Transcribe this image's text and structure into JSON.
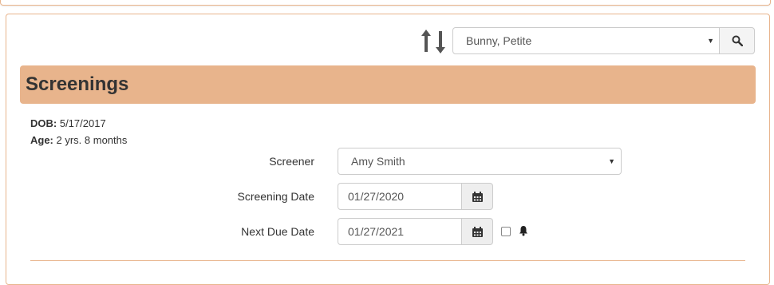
{
  "patient_picker": {
    "selected": "Bunny, Petite",
    "sort_icon": "sort-up-down-icon",
    "search_icon": "search-icon"
  },
  "header": {
    "title": "Screenings",
    "bar_color": "#e8b48c"
  },
  "patient_info": {
    "dob_label": "DOB:",
    "dob_value": "5/17/2017",
    "age_label": "Age:",
    "age_value": "2 yrs. 8 months"
  },
  "form": {
    "screener_label": "Screener",
    "screener_value": "Amy Smith",
    "screening_date_label": "Screening Date",
    "screening_date_value": "01/27/2020",
    "next_due_label": "Next Due Date",
    "next_due_value": "01/27/2021",
    "reminder_checked": false,
    "calendar_icon": "calendar-icon",
    "bell_icon": "bell-icon"
  },
  "colors": {
    "accent": "#e8b48c",
    "text": "#333333",
    "input_border": "#cccccc"
  }
}
